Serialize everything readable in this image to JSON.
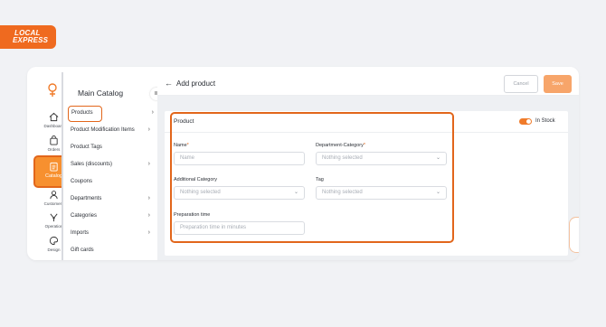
{
  "brand": {
    "line1": "LOCAL",
    "line2": "EXPRESS",
    "accent": "#ef6a1f"
  },
  "rail": [
    {
      "label": "Dashboard",
      "icon": "home-icon"
    },
    {
      "label": "Orders",
      "icon": "bag-icon"
    },
    {
      "label": "Catalog",
      "icon": "clipboard-icon",
      "active": true
    },
    {
      "label": "Customers",
      "icon": "users-icon"
    },
    {
      "label": "Operation",
      "icon": "operation-icon"
    },
    {
      "label": "Design",
      "icon": "palette-icon"
    }
  ],
  "menu": {
    "title": "Main Catalog",
    "items": [
      {
        "label": "Products",
        "chevron": true,
        "highlighted": true
      },
      {
        "label": "Product Modification Items",
        "chevron": true
      },
      {
        "label": "Product Tags",
        "chevron": false
      },
      {
        "label": "Sales (discounts)",
        "chevron": true
      },
      {
        "label": "Coupons",
        "chevron": false
      },
      {
        "label": "Departments",
        "chevron": true
      },
      {
        "label": "Categories",
        "chevron": true
      },
      {
        "label": "Imports",
        "chevron": true
      },
      {
        "label": "Gift cards",
        "chevron": false
      }
    ]
  },
  "header": {
    "title": "Add product",
    "cancel_label": "Cancel",
    "save_label": "Save"
  },
  "product_card": {
    "title": "Product",
    "in_stock_label": "In Stock",
    "in_stock_on": true,
    "name": {
      "label": "Name",
      "required": "*",
      "placeholder": "Name"
    },
    "department_category": {
      "label": "Department-Category",
      "required": "*",
      "value": "Nothing selected"
    },
    "additional_category": {
      "label": "Additional Category",
      "value": "Nothing selected"
    },
    "tag": {
      "label": "Tag",
      "value": "Nothing selected"
    },
    "preparation_time": {
      "label": "Preparation time",
      "placeholder": "Preparation time in minutes"
    }
  }
}
